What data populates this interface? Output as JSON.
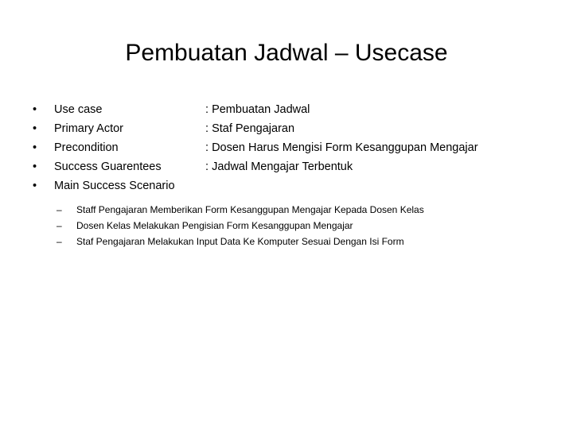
{
  "slide": {
    "title": "Pembuatan Jadwal – Usecase",
    "background_color": "#ffffff",
    "text_color": "#000000",
    "bullet_glyph": "•",
    "dash_glyph": "–",
    "separator": ":",
    "level1": [
      {
        "label": "Use case",
        "separator": ":",
        "value": "Pembuatan Jadwal"
      },
      {
        "label": "Primary Actor",
        "separator": ":",
        "value": "Staf Pengajaran"
      },
      {
        "label": "Precondition",
        "separator": ":",
        "value": "Dosen Harus Mengisi Form Kesanggupan Mengajar"
      },
      {
        "label": "Success Guarentees",
        "separator": ":",
        "value": "Jadwal Mengajar Terbentuk"
      },
      {
        "label": "Main Success Scenario",
        "separator": "",
        "value": ""
      }
    ],
    "level2": [
      {
        "text": "Staff Pengajaran Memberikan Form Kesanggupan Mengajar Kepada Dosen Kelas"
      },
      {
        "text": "Dosen Kelas Melakukan Pengisian Form Kesanggupan Mengajar"
      },
      {
        "text": "Staf Pengajaran Melakukan Input Data Ke Komputer Sesuai Dengan Isi Form"
      }
    ]
  }
}
